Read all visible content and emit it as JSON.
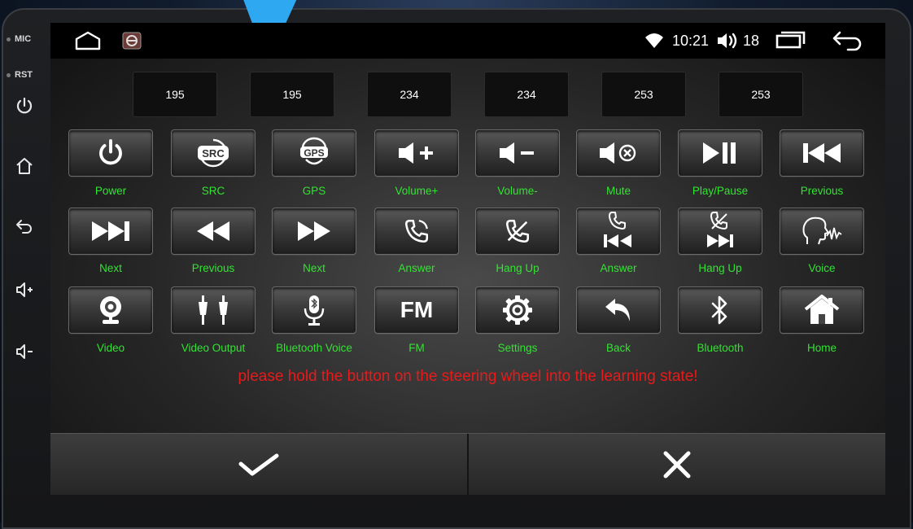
{
  "side_panel": {
    "mic_label": "MIC",
    "rst_label": "RST",
    "icons": [
      "power-icon",
      "home-icon",
      "back-icon",
      "volume-up-icon",
      "volume-down-icon"
    ]
  },
  "status_bar": {
    "time": "10:21",
    "volume": "18",
    "icons": [
      "home-icon",
      "steering-wheel-app-icon",
      "wifi-icon",
      "volume-icon",
      "recent-apps-icon",
      "back-icon"
    ]
  },
  "learned_values": [
    "195",
    "195",
    "234",
    "234",
    "253",
    "253"
  ],
  "buttons": [
    {
      "label": "Power",
      "icon": "power-icon"
    },
    {
      "label": "SRC",
      "icon": "src-icon"
    },
    {
      "label": "GPS",
      "icon": "gps-icon"
    },
    {
      "label": "Volume+",
      "icon": "volume-up-icon"
    },
    {
      "label": "Volume-",
      "icon": "volume-down-icon"
    },
    {
      "label": "Mute",
      "icon": "mute-icon"
    },
    {
      "label": "Play/Pause",
      "icon": "play-pause-icon"
    },
    {
      "label": "Previous",
      "icon": "previous-icon"
    },
    {
      "label": "Next",
      "icon": "next-icon"
    },
    {
      "label": "Previous",
      "icon": "rewind-icon"
    },
    {
      "label": "Next",
      "icon": "fast-forward-icon"
    },
    {
      "label": "Answer",
      "icon": "phone-answer-icon"
    },
    {
      "label": "Hang Up",
      "icon": "phone-hangup-icon"
    },
    {
      "label": "Answer",
      "icon": "phone-answer-previous-icon"
    },
    {
      "label": "Hang Up",
      "icon": "phone-hangup-next-icon"
    },
    {
      "label": "Voice",
      "icon": "voice-icon"
    },
    {
      "label": "Video",
      "icon": "webcam-icon"
    },
    {
      "label": "Video Output",
      "icon": "rca-cable-icon"
    },
    {
      "label": "Bluetooth Voice",
      "icon": "microphone-icon"
    },
    {
      "label": "FM",
      "icon": "fm-icon",
      "text": "FM"
    },
    {
      "label": "Settings",
      "icon": "gear-icon"
    },
    {
      "label": "Back",
      "icon": "back-arrow-icon"
    },
    {
      "label": "Bluetooth",
      "icon": "bluetooth-icon"
    },
    {
      "label": "Home",
      "icon": "home-icon"
    }
  ],
  "notice": "please hold the button on the steering wheel into the learning state!",
  "bottom_bar": {
    "confirm_icon": "check-icon",
    "cancel_icon": "close-icon"
  },
  "colors": {
    "label_green": "#33e233",
    "notice_red": "#e81a1a",
    "pointer_blue": "#2ea8f0"
  }
}
